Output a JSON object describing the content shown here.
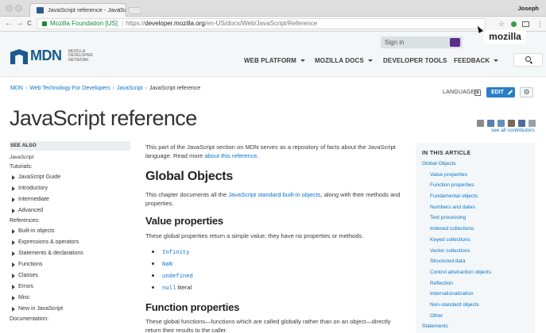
{
  "browser": {
    "tab_title": "JavaScript reference - JavaSc",
    "tab_close": "×",
    "user": "Joseph",
    "back": "←",
    "forward": "→",
    "reload": "C",
    "security_label": "Mozilla Foundation [US]",
    "url_scheme": "https://",
    "url_host": "developer.mozilla.org",
    "url_path": "/en-US/docs/Web/JavaScript/Reference",
    "star_icon": "☆",
    "menu_icon": "⋮"
  },
  "header": {
    "logo_text": "MDN",
    "logo_subtext": "Mozilla Developer Network",
    "signin_label": "Sign in",
    "mozilla_badge": "mozilla",
    "nav": [
      "WEB PLATFORM",
      "MOZILLA DOCS",
      "DEVELOPER TOOLS",
      "FEEDBACK"
    ]
  },
  "breadcrumb": [
    "MDN",
    "Web Technology For Developers",
    "JavaScript",
    "JavaScript reference"
  ],
  "actions": {
    "languages": "LANGUAGES",
    "edit": "EDIT",
    "gear": "⚙"
  },
  "page": {
    "title": "JavaScript reference",
    "contributors_link": "see all contributors"
  },
  "contributors": {
    "colors": [
      "#8a8a8a",
      "#5a7fb0",
      "#6a8fc0",
      "#7a6a5a",
      "#4a6f9f",
      "#9aa0a8"
    ]
  },
  "sidebar": {
    "see_also": "SEE ALSO",
    "js_label": "JavaScript",
    "tutorials_label": "Tutorials:",
    "tutorials": [
      "JavaScript Guide",
      "Introductory",
      "Intermediate",
      "Advanced"
    ],
    "references_label": "References:",
    "references": [
      "Built-in objects",
      "Expressions & operators",
      "Statements & declarations",
      "Functions",
      "Classes",
      "Errors",
      "Misc",
      "New in JavaScript"
    ],
    "documentation_label": "Documentation:"
  },
  "article": {
    "intro_before": "This part of the JavaScript section on MDN serves as a repository of facts about the JavaScript language. Read more ",
    "intro_link": "about this reference",
    "intro_after": ".",
    "global_objects_heading": "Global Objects",
    "global_before": "This chapter documents all the ",
    "global_link": "JavaScript standard built-in objects",
    "global_after": ", along with their methods and properties.",
    "value_props_heading": "Value properties",
    "value_props_text": "These global properties return a simple value; they have no properties or methods.",
    "value_items": [
      "Infinity",
      "NaN",
      "undefined",
      "null"
    ],
    "null_suffix": " literal",
    "function_props_heading": "Function properties",
    "function_props_text": "These global functions—functions which are called globally rather than on an object—directly return their results to the caller."
  },
  "toc": {
    "heading": "IN THIS ARTICLE",
    "top": "Global Objects",
    "items": [
      "Value properties",
      "Function properties",
      "Fundamental objects",
      "Numbers and dates",
      "Text processing",
      "Indexed collections",
      "Keyed collections",
      "Vector collections",
      "Structured data",
      "Control abstraction objects",
      "Reflection",
      "Internationalization",
      "Non-standard objects",
      "Other"
    ],
    "last": "Statements"
  }
}
